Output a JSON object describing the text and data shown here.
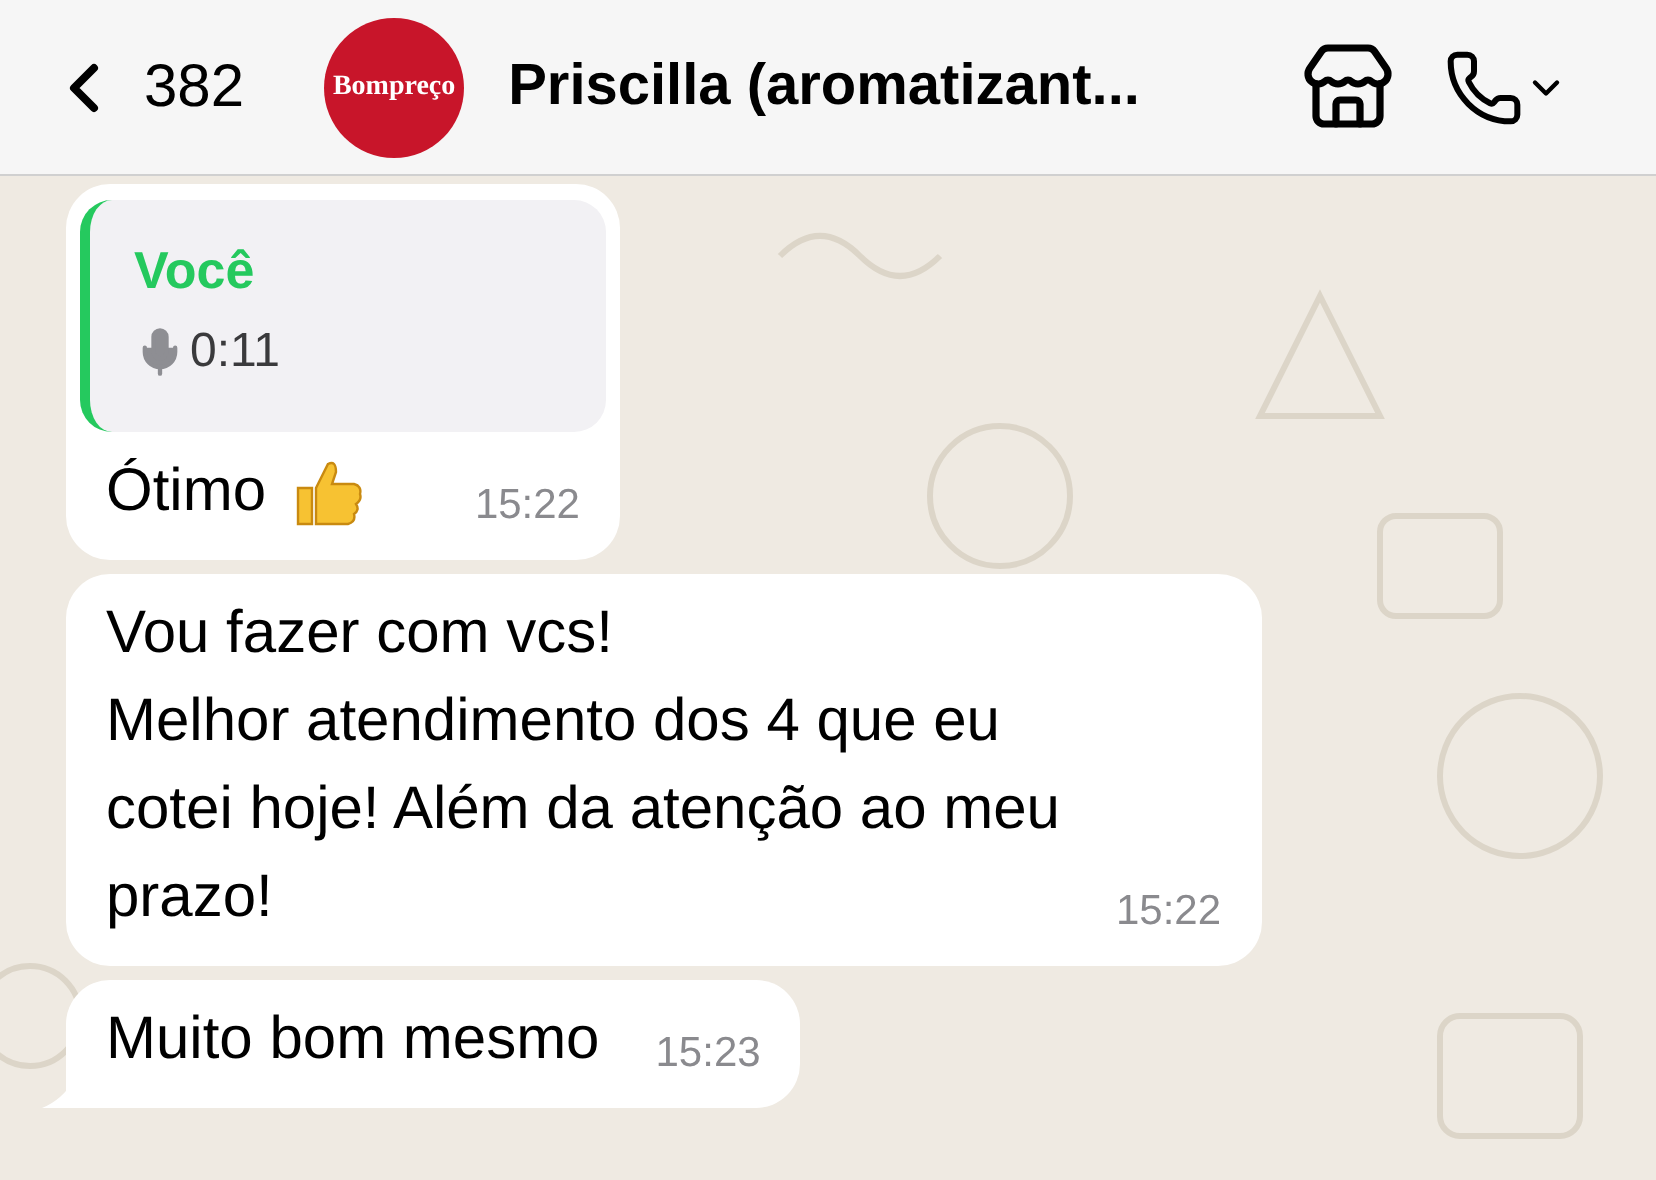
{
  "header": {
    "back_count": "382",
    "avatar_logo": "Bompreço",
    "title": "Priscilla (aromatizant..."
  },
  "messages": [
    {
      "kind": "reply",
      "quote": {
        "author": "Você",
        "duration": "0:11"
      },
      "text": "Ótimo",
      "thumbs_up": true,
      "time": "15:22",
      "tail": false
    },
    {
      "kind": "text",
      "text": "Vou fazer com vcs!\nMelhor atendimento dos 4 que eu\ncotei hoje! Além da atenção ao meu\nprazo!",
      "thumbs_up": false,
      "time": "15:22",
      "tail": false
    },
    {
      "kind": "text",
      "text": "Muito bom mesmo",
      "thumbs_up": false,
      "time": "15:23",
      "tail": true
    }
  ]
}
